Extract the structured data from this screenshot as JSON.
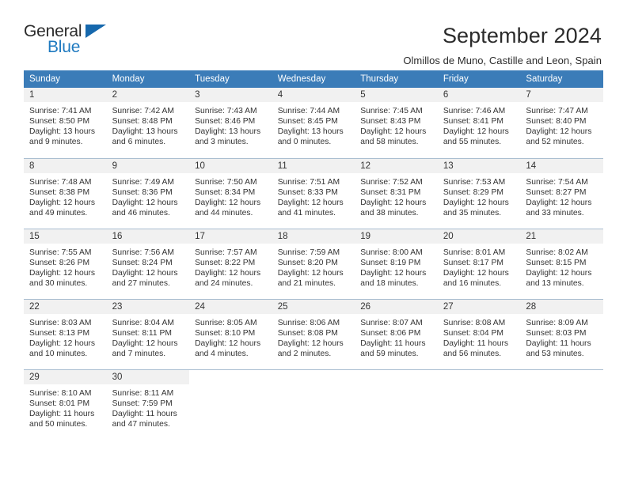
{
  "logo": {
    "word_one": "General",
    "word_two": "Blue",
    "triangle_icon": "triangle-icon"
  },
  "header": {
    "title": "September 2024",
    "subtitle": "Olmillos de Muno, Castille and Leon, Spain"
  },
  "colors": {
    "header_blue": "#3b7cb8",
    "logo_blue": "#1f7ac0",
    "daynum_band": "#f1f1f1",
    "row_rule": "#a9bdd0",
    "text": "#333333"
  },
  "weekdays": [
    "Sunday",
    "Monday",
    "Tuesday",
    "Wednesday",
    "Thursday",
    "Friday",
    "Saturday"
  ],
  "weeks": [
    [
      {
        "day": "1",
        "sunrise": "Sunrise: 7:41 AM",
        "sunset": "Sunset: 8:50 PM",
        "daylight1": "Daylight: 13 hours",
        "daylight2": "and 9 minutes."
      },
      {
        "day": "2",
        "sunrise": "Sunrise: 7:42 AM",
        "sunset": "Sunset: 8:48 PM",
        "daylight1": "Daylight: 13 hours",
        "daylight2": "and 6 minutes."
      },
      {
        "day": "3",
        "sunrise": "Sunrise: 7:43 AM",
        "sunset": "Sunset: 8:46 PM",
        "daylight1": "Daylight: 13 hours",
        "daylight2": "and 3 minutes."
      },
      {
        "day": "4",
        "sunrise": "Sunrise: 7:44 AM",
        "sunset": "Sunset: 8:45 PM",
        "daylight1": "Daylight: 13 hours",
        "daylight2": "and 0 minutes."
      },
      {
        "day": "5",
        "sunrise": "Sunrise: 7:45 AM",
        "sunset": "Sunset: 8:43 PM",
        "daylight1": "Daylight: 12 hours",
        "daylight2": "and 58 minutes."
      },
      {
        "day": "6",
        "sunrise": "Sunrise: 7:46 AM",
        "sunset": "Sunset: 8:41 PM",
        "daylight1": "Daylight: 12 hours",
        "daylight2": "and 55 minutes."
      },
      {
        "day": "7",
        "sunrise": "Sunrise: 7:47 AM",
        "sunset": "Sunset: 8:40 PM",
        "daylight1": "Daylight: 12 hours",
        "daylight2": "and 52 minutes."
      }
    ],
    [
      {
        "day": "8",
        "sunrise": "Sunrise: 7:48 AM",
        "sunset": "Sunset: 8:38 PM",
        "daylight1": "Daylight: 12 hours",
        "daylight2": "and 49 minutes."
      },
      {
        "day": "9",
        "sunrise": "Sunrise: 7:49 AM",
        "sunset": "Sunset: 8:36 PM",
        "daylight1": "Daylight: 12 hours",
        "daylight2": "and 46 minutes."
      },
      {
        "day": "10",
        "sunrise": "Sunrise: 7:50 AM",
        "sunset": "Sunset: 8:34 PM",
        "daylight1": "Daylight: 12 hours",
        "daylight2": "and 44 minutes."
      },
      {
        "day": "11",
        "sunrise": "Sunrise: 7:51 AM",
        "sunset": "Sunset: 8:33 PM",
        "daylight1": "Daylight: 12 hours",
        "daylight2": "and 41 minutes."
      },
      {
        "day": "12",
        "sunrise": "Sunrise: 7:52 AM",
        "sunset": "Sunset: 8:31 PM",
        "daylight1": "Daylight: 12 hours",
        "daylight2": "and 38 minutes."
      },
      {
        "day": "13",
        "sunrise": "Sunrise: 7:53 AM",
        "sunset": "Sunset: 8:29 PM",
        "daylight1": "Daylight: 12 hours",
        "daylight2": "and 35 minutes."
      },
      {
        "day": "14",
        "sunrise": "Sunrise: 7:54 AM",
        "sunset": "Sunset: 8:27 PM",
        "daylight1": "Daylight: 12 hours",
        "daylight2": "and 33 minutes."
      }
    ],
    [
      {
        "day": "15",
        "sunrise": "Sunrise: 7:55 AM",
        "sunset": "Sunset: 8:26 PM",
        "daylight1": "Daylight: 12 hours",
        "daylight2": "and 30 minutes."
      },
      {
        "day": "16",
        "sunrise": "Sunrise: 7:56 AM",
        "sunset": "Sunset: 8:24 PM",
        "daylight1": "Daylight: 12 hours",
        "daylight2": "and 27 minutes."
      },
      {
        "day": "17",
        "sunrise": "Sunrise: 7:57 AM",
        "sunset": "Sunset: 8:22 PM",
        "daylight1": "Daylight: 12 hours",
        "daylight2": "and 24 minutes."
      },
      {
        "day": "18",
        "sunrise": "Sunrise: 7:59 AM",
        "sunset": "Sunset: 8:20 PM",
        "daylight1": "Daylight: 12 hours",
        "daylight2": "and 21 minutes."
      },
      {
        "day": "19",
        "sunrise": "Sunrise: 8:00 AM",
        "sunset": "Sunset: 8:19 PM",
        "daylight1": "Daylight: 12 hours",
        "daylight2": "and 18 minutes."
      },
      {
        "day": "20",
        "sunrise": "Sunrise: 8:01 AM",
        "sunset": "Sunset: 8:17 PM",
        "daylight1": "Daylight: 12 hours",
        "daylight2": "and 16 minutes."
      },
      {
        "day": "21",
        "sunrise": "Sunrise: 8:02 AM",
        "sunset": "Sunset: 8:15 PM",
        "daylight1": "Daylight: 12 hours",
        "daylight2": "and 13 minutes."
      }
    ],
    [
      {
        "day": "22",
        "sunrise": "Sunrise: 8:03 AM",
        "sunset": "Sunset: 8:13 PM",
        "daylight1": "Daylight: 12 hours",
        "daylight2": "and 10 minutes."
      },
      {
        "day": "23",
        "sunrise": "Sunrise: 8:04 AM",
        "sunset": "Sunset: 8:11 PM",
        "daylight1": "Daylight: 12 hours",
        "daylight2": "and 7 minutes."
      },
      {
        "day": "24",
        "sunrise": "Sunrise: 8:05 AM",
        "sunset": "Sunset: 8:10 PM",
        "daylight1": "Daylight: 12 hours",
        "daylight2": "and 4 minutes."
      },
      {
        "day": "25",
        "sunrise": "Sunrise: 8:06 AM",
        "sunset": "Sunset: 8:08 PM",
        "daylight1": "Daylight: 12 hours",
        "daylight2": "and 2 minutes."
      },
      {
        "day": "26",
        "sunrise": "Sunrise: 8:07 AM",
        "sunset": "Sunset: 8:06 PM",
        "daylight1": "Daylight: 11 hours",
        "daylight2": "and 59 minutes."
      },
      {
        "day": "27",
        "sunrise": "Sunrise: 8:08 AM",
        "sunset": "Sunset: 8:04 PM",
        "daylight1": "Daylight: 11 hours",
        "daylight2": "and 56 minutes."
      },
      {
        "day": "28",
        "sunrise": "Sunrise: 8:09 AM",
        "sunset": "Sunset: 8:03 PM",
        "daylight1": "Daylight: 11 hours",
        "daylight2": "and 53 minutes."
      }
    ],
    [
      {
        "day": "29",
        "sunrise": "Sunrise: 8:10 AM",
        "sunset": "Sunset: 8:01 PM",
        "daylight1": "Daylight: 11 hours",
        "daylight2": "and 50 minutes."
      },
      {
        "day": "30",
        "sunrise": "Sunrise: 8:11 AM",
        "sunset": "Sunset: 7:59 PM",
        "daylight1": "Daylight: 11 hours",
        "daylight2": "and 47 minutes."
      },
      {
        "day": "",
        "sunrise": "",
        "sunset": "",
        "daylight1": "",
        "daylight2": ""
      },
      {
        "day": "",
        "sunrise": "",
        "sunset": "",
        "daylight1": "",
        "daylight2": ""
      },
      {
        "day": "",
        "sunrise": "",
        "sunset": "",
        "daylight1": "",
        "daylight2": ""
      },
      {
        "day": "",
        "sunrise": "",
        "sunset": "",
        "daylight1": "",
        "daylight2": ""
      },
      {
        "day": "",
        "sunrise": "",
        "sunset": "",
        "daylight1": "",
        "daylight2": ""
      }
    ]
  ]
}
